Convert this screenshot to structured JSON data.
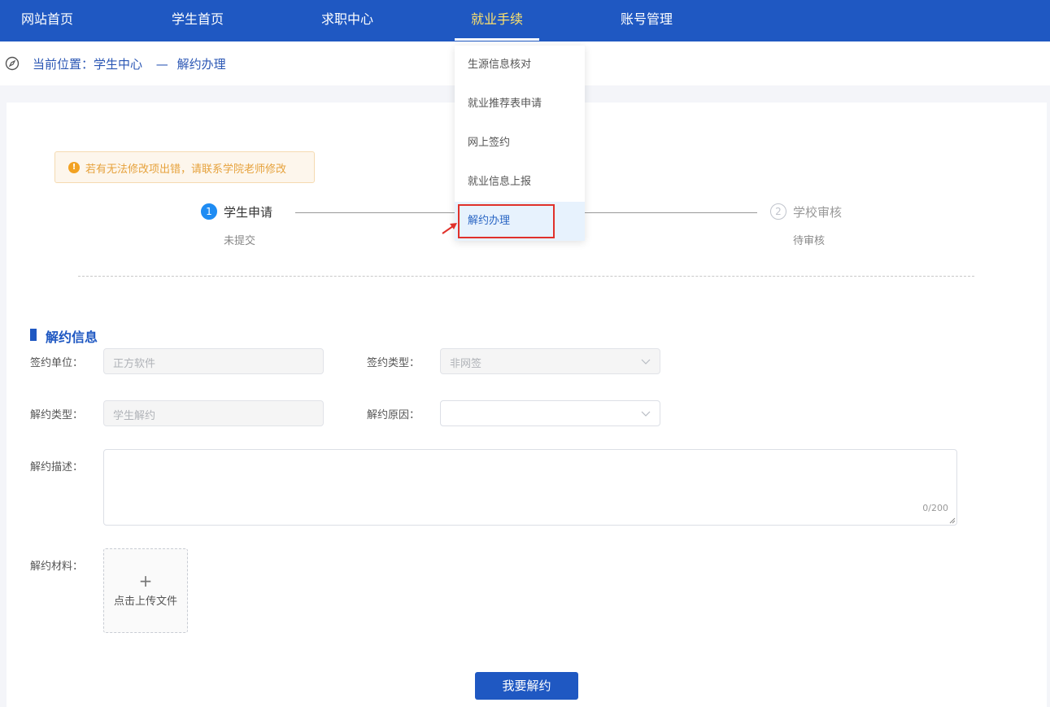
{
  "nav": {
    "items": [
      "网站首页",
      "学生首页",
      "求职中心",
      "就业手续",
      "账号管理"
    ],
    "active_index": 3
  },
  "breadcrumb": {
    "prefix": "当前位置：学生中心",
    "separator": "—",
    "current": "解约办理"
  },
  "alert": {
    "icon": "!",
    "text": "若有无法修改项出错，请联系学院老师修改"
  },
  "steps": [
    {
      "number": "1",
      "title": "学生申请",
      "status": "未提交"
    },
    {
      "number": "2",
      "title": "学校审核",
      "status": "待审核"
    }
  ],
  "section": {
    "title": "解约信息"
  },
  "form": {
    "sign_unit_label": "签约单位：",
    "sign_unit_value": "正方软件",
    "sign_type_label": "签约类型：",
    "sign_type_value": "非网签",
    "termination_type_label": "解约类型：",
    "termination_type_value": "学生解约",
    "termination_reason_label": "解约原因：",
    "termination_reason_value": "",
    "description_label": "解约描述：",
    "description_counter": "0/200",
    "materials_label": "解约材料：",
    "upload_plus": "+",
    "upload_text": "点击上传文件"
  },
  "submit_label": "我要解约",
  "dropdown": {
    "items": [
      "生源信息核对",
      "就业推荐表申请",
      "网上签约",
      "就业信息上报",
      "解约办理"
    ],
    "active_index": 4
  },
  "colors": {
    "nav_bg": "#1f58c2",
    "nav_active_text": "#ffe36b",
    "primary": "#1f58c2",
    "step_active": "#1f8cf3",
    "alert_text": "#e6a23c",
    "highlight": "#e0312b"
  }
}
